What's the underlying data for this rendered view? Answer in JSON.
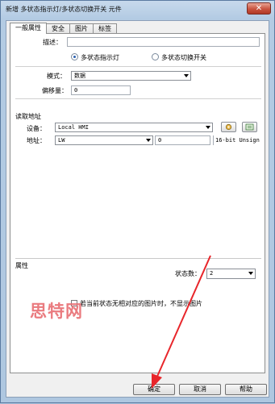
{
  "window": {
    "title": "新增 多状态指示灯/多状态切换开关 元件",
    "close_glyph": "✕"
  },
  "tabs": [
    {
      "label": "一般属性",
      "active": true
    },
    {
      "label": "安全",
      "active": false
    },
    {
      "label": "图片",
      "active": false
    },
    {
      "label": "标签",
      "active": false
    }
  ],
  "general": {
    "description_label": "描述：",
    "description_value": "",
    "radio_indicator_label": "多状态指示灯",
    "radio_indicator_selected": true,
    "radio_switch_label": "多状态切换开关",
    "radio_switch_selected": false,
    "mode_label": "模式：",
    "mode_value": "数据",
    "offset_label": "偏移量：",
    "offset_value": "0"
  },
  "read_address": {
    "group_label": "读取地址",
    "device_label": "设备：",
    "device_value": "Local HMI",
    "address_label": "地址：",
    "address_type": "LW",
    "address_value": "0",
    "data_format": "16-bit Unsign"
  },
  "properties": {
    "group_label": "属性",
    "state_count_label": "状态数：",
    "state_count_value": "2",
    "hide_checkbox_label": "若当前状态无相对应的图片时，不显示图片",
    "hide_checkbox_checked": false
  },
  "buttons": {
    "ok": "确定",
    "cancel": "取消",
    "help": "帮助"
  },
  "watermark": "思特网",
  "colors": {
    "annotation_red": "#e8262b",
    "watermark": "#e86d72",
    "selected_radio": "#2a5fb0"
  }
}
